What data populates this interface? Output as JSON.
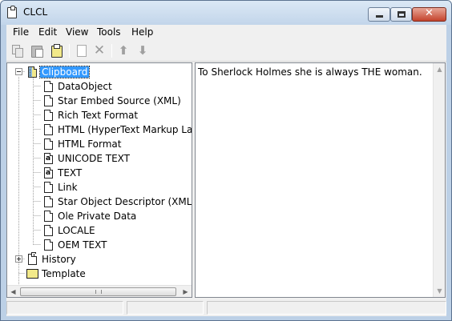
{
  "window": {
    "title": "CLCL",
    "minimize_icon": "minimize-icon",
    "maximize_icon": "maximize-icon",
    "close_icon": "close-icon",
    "close_glyph": "✕"
  },
  "menu": {
    "items": [
      {
        "label": "File"
      },
      {
        "label": "Edit"
      },
      {
        "label": "View"
      },
      {
        "label": "Tools"
      },
      {
        "label": "Help"
      }
    ]
  },
  "toolbar": {
    "buttons": [
      {
        "icon": "copy-icon",
        "enabled": false
      },
      {
        "icon": "paste-icon",
        "enabled": false
      },
      {
        "icon": "clipboard-icon",
        "enabled": true
      },
      {
        "icon": "new-document-icon",
        "enabled": false
      },
      {
        "icon": "delete-icon",
        "enabled": false,
        "glyph": "✕"
      },
      {
        "icon": "arrow-up-icon",
        "enabled": false,
        "glyph": "⬆"
      },
      {
        "icon": "arrow-down-icon",
        "enabled": false,
        "glyph": "⬇"
      }
    ]
  },
  "tree": {
    "root": {
      "label": "Clipboard",
      "icon": "clipboard-book-icon",
      "expanded": true,
      "selected": true
    },
    "formats": [
      {
        "label": "DataObject",
        "icon": "document-icon"
      },
      {
        "label": "Star Embed Source (XML)",
        "icon": "document-icon"
      },
      {
        "label": "Rich Text Format",
        "icon": "document-icon"
      },
      {
        "label": "HTML (HyperText Markup Lang",
        "icon": "document-icon"
      },
      {
        "label": "HTML Format",
        "icon": "document-icon"
      },
      {
        "label": "UNICODE TEXT",
        "icon": "text-document-icon"
      },
      {
        "label": "TEXT",
        "icon": "text-document-icon"
      },
      {
        "label": "Link",
        "icon": "document-icon"
      },
      {
        "label": "Star Object Descriptor (XML)",
        "icon": "document-icon"
      },
      {
        "label": "Ole Private Data",
        "icon": "document-icon"
      },
      {
        "label": "LOCALE",
        "icon": "document-icon"
      },
      {
        "label": "OEM TEXT",
        "icon": "document-icon"
      }
    ],
    "history": {
      "label": "History",
      "icon": "history-icon",
      "expanded": false
    },
    "template": {
      "label": "Template",
      "icon": "template-folder-icon"
    },
    "text_glyph": "a"
  },
  "content": {
    "text": "To Sherlock Holmes she is always THE woman."
  },
  "scroll": {
    "left_glyph": "◀",
    "right_glyph": "▶",
    "up_glyph": "▲",
    "down_glyph": "▼"
  },
  "status": {
    "panels": [
      "",
      "",
      ""
    ]
  }
}
